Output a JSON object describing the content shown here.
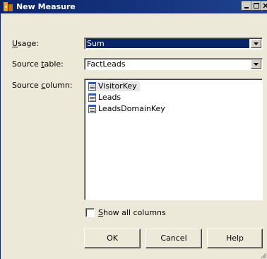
{
  "window": {
    "title": "New Measure",
    "title_icon": "measure-icon",
    "controls": [
      "minimize-icon",
      "maximize-icon",
      "close-icon"
    ]
  },
  "usage": {
    "accesskey": "U",
    "label_rest": "sage:",
    "value": "Sum"
  },
  "source_table": {
    "label_before": "Source ",
    "accesskey": "t",
    "label_after": "able:",
    "value": "FactLeads"
  },
  "source_column": {
    "label_before": "Source ",
    "accesskey": "c",
    "label_after": "olumn:",
    "items": [
      {
        "label": "VisitorKey",
        "icon": "column-icon",
        "highlighted": true
      },
      {
        "label": "Leads",
        "icon": "column-icon",
        "highlighted": false
      },
      {
        "label": "LeadsDomainKey",
        "icon": "column-icon",
        "highlighted": false
      }
    ]
  },
  "show_all_columns": {
    "accesskey": "S",
    "label_rest": "how all columns",
    "checked": false
  },
  "buttons": {
    "ok": "OK",
    "cancel": "Cancel",
    "help": "Help"
  },
  "colors": {
    "title_bar": "#0a246a",
    "selection": "#0a246a",
    "dialog_face": "#ece9d8"
  }
}
